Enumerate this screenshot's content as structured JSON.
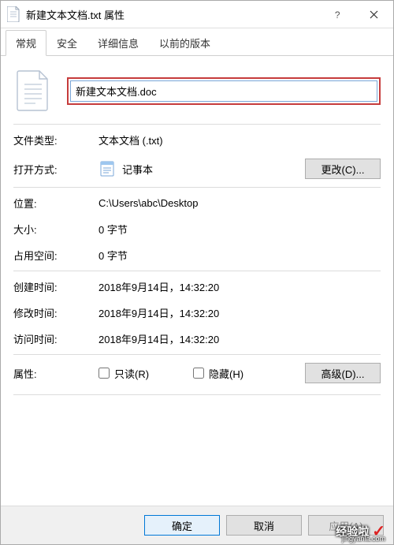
{
  "window": {
    "title": "新建文本文档.txt 属性"
  },
  "tabs": {
    "general": "常规",
    "security": "安全",
    "details": "详细信息",
    "previous": "以前的版本"
  },
  "filename": {
    "value": "新建文本文档.doc"
  },
  "labels": {
    "file_type": "文件类型:",
    "open_with": "打开方式:",
    "location": "位置:",
    "size": "大小:",
    "size_on_disk": "占用空间:",
    "created": "创建时间:",
    "modified": "修改时间:",
    "accessed": "访问时间:",
    "attributes": "属性:"
  },
  "values": {
    "file_type": "文本文档 (.txt)",
    "open_with_app": "记事本",
    "location": "C:\\Users\\abc\\Desktop",
    "size": "0 字节",
    "size_on_disk": "0 字节",
    "created": "2018年9月14日，14:32:20",
    "modified": "2018年9月14日，14:32:20",
    "accessed": "2018年9月14日，14:32:20"
  },
  "buttons": {
    "change": "更改(C)...",
    "advanced": "高级(D)...",
    "ok": "确定",
    "cancel": "取消",
    "apply": "应用(A)"
  },
  "checkboxes": {
    "readonly": "只读(R)",
    "hidden": "隐藏(H)"
  },
  "watermark": {
    "brand": "经验啦",
    "url": "jingyanla.com"
  }
}
